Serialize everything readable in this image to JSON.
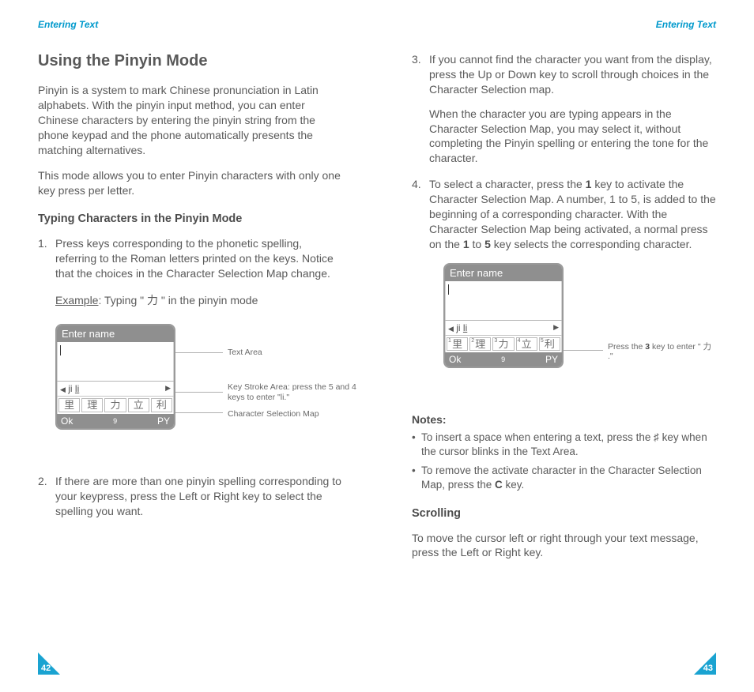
{
  "header": {
    "left": "Entering Text",
    "right": "Entering Text"
  },
  "left": {
    "title": "Using the Pinyin Mode",
    "intro1": "Pinyin is a system to mark Chinese pronunciation in Latin alphabets. With the pinyin input method, you can enter Chinese characters by entering the pinyin string from the phone keypad and the phone automatically presents the matching alternatives.",
    "intro2": "This mode allows you to enter Pinyin characters with only one key press per letter.",
    "sub1": "Typing Characters in the Pinyin Mode",
    "step1": "Press keys corresponding to the phonetic spelling, referring to the Roman letters printed on the keys. Notice that the choices in the Character Selection Map change.",
    "example_label": "Example",
    "example_rest": ": Typing \" 力 \" in the pinyin mode",
    "phone1": {
      "title": "Enter name",
      "key_left": "◀ ji",
      "key_mid": "li",
      "key_right": "▶",
      "chars": [
        "里",
        "理",
        "力",
        "立",
        "利"
      ],
      "foot_left": "Ok",
      "foot_mid": "9",
      "foot_right": "PY"
    },
    "callouts": {
      "c1": "Text Area",
      "c2": "Key Stroke Area: press the 5 and 4 keys to enter \"li.\"",
      "c3": "Character Selection Map"
    },
    "step2": "If there are more than one pinyin spelling corresponding to your keypress, press the Left or Right key to select the spelling you want.",
    "page_num": "42"
  },
  "right": {
    "step3": "If you cannot find the character you want from the display, press the Up or Down key to scroll through choices in the Character Selection map.",
    "step3b": "When the character you are typing appears in the Character Selection Map, you may select it, without completing the Pinyin spelling or entering the tone for the character.",
    "step4a": "To select a character, press the ",
    "step4_key1": "1",
    "step4b": " key to activate the Character Selection Map. A number, 1 to 5, is added to the beginning of a corresponding character. With the Character Selection Map being activated, a normal press on the ",
    "step4_key2": "1",
    "step4c": " to ",
    "step4_key3": "5",
    "step4d": " key selects the corresponding character.",
    "phone2": {
      "title": "Enter name",
      "key_left": "◀ ji",
      "key_mid": "li",
      "key_right": "▶",
      "chars": [
        "里",
        "理",
        "力",
        "立",
        "利"
      ],
      "sups": [
        "1",
        "2",
        "3",
        "4",
        "5"
      ],
      "foot_left": "Ok",
      "foot_mid": "9",
      "foot_right": "PY"
    },
    "callout2a": "Press the ",
    "callout2_key": "3",
    "callout2b": " key to enter \" 力 .\"",
    "notes_head": "Notes",
    "note1": "To insert a space when entering a text, press the ♯ key when the cursor blinks in the Text Area.",
    "note2a": "To remove the activate character in the Character Selection Map, press the ",
    "note2_key": "C",
    "note2b": " key.",
    "sub2": "Scrolling",
    "scroll_body": "To move the cursor left or right through your text message, press the Left or Right key.",
    "page_num": "43"
  }
}
